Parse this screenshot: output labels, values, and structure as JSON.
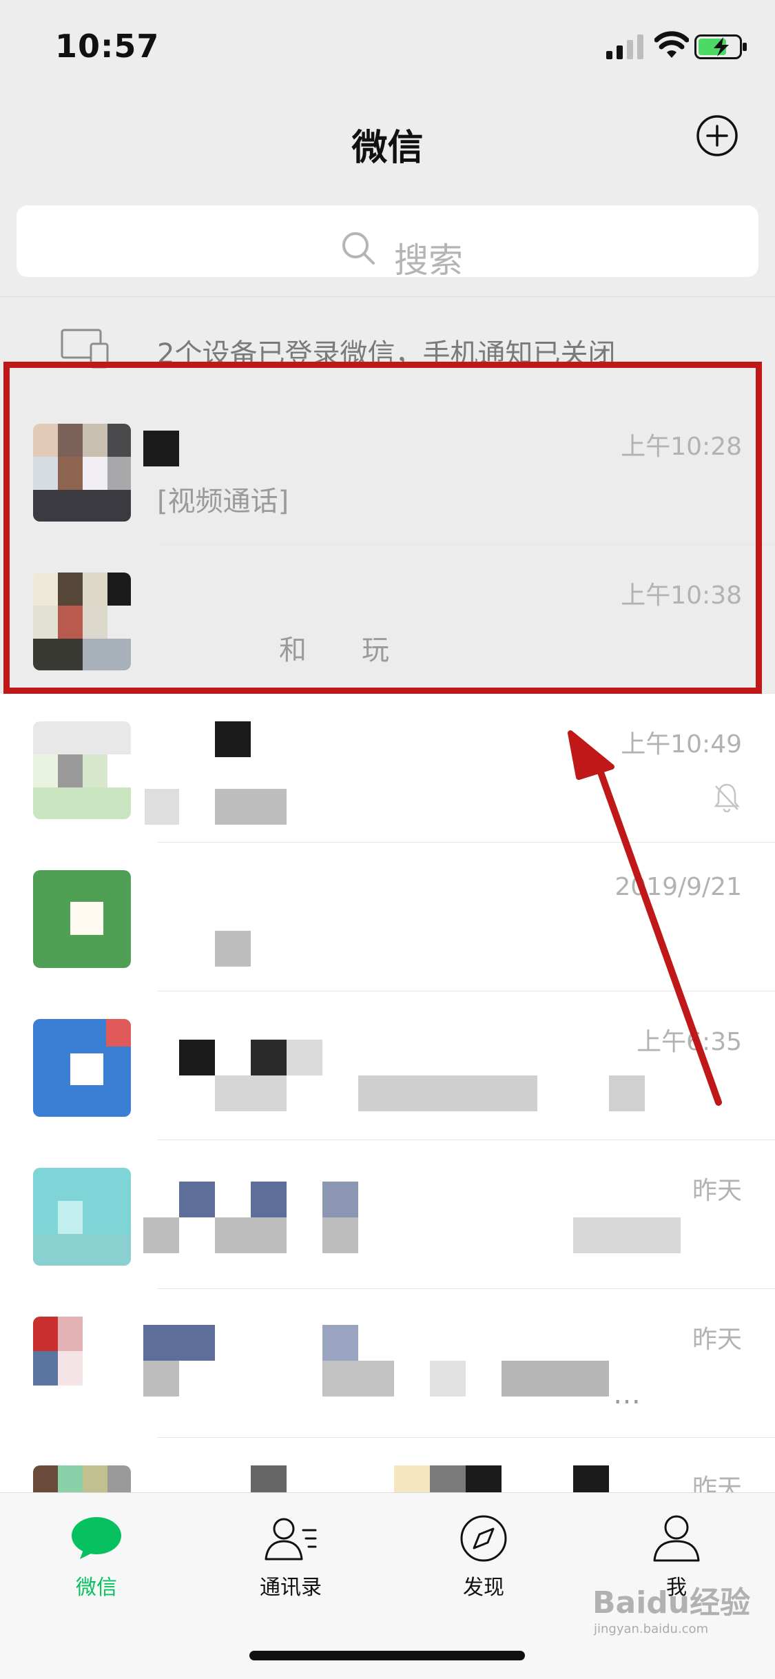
{
  "status_bar": {
    "time": "10:57"
  },
  "nav": {
    "title": "微信"
  },
  "search": {
    "placeholder": "搜索"
  },
  "device_notice": {
    "text": "2个设备已登录微信，手机通知已关闭"
  },
  "chats": [
    {
      "time": "上午10:28",
      "preview": "[视频通话]",
      "highlighted": true
    },
    {
      "time": "上午10:38",
      "preview": "和　　玩",
      "highlighted": true
    },
    {
      "time": "上午10:49",
      "preview": "",
      "muted": true
    },
    {
      "time": "2019/9/21",
      "preview": ""
    },
    {
      "time": "上午6:35",
      "preview": ""
    },
    {
      "time": "昨天",
      "preview": ""
    },
    {
      "time": "昨天",
      "preview": "…"
    },
    {
      "time": "昨天",
      "preview": ""
    }
  ],
  "tabs": [
    {
      "label": "微信",
      "icon": "chat-bubble-icon",
      "active": true
    },
    {
      "label": "通讯录",
      "icon": "contacts-icon"
    },
    {
      "label": "发现",
      "icon": "compass-icon"
    },
    {
      "label": "我",
      "icon": "person-icon"
    }
  ],
  "watermark": {
    "text": "Baidu经验",
    "sub": "jingyan.baidu.com"
  },
  "colors": {
    "accent": "#07c160",
    "annotation": "#c01818",
    "background": "#ededed"
  }
}
